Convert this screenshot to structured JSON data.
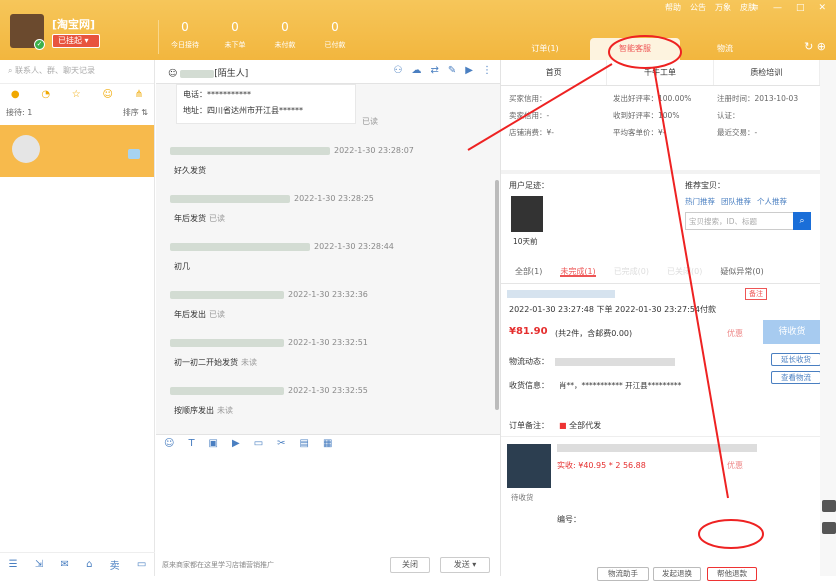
{
  "topbar": {
    "username": "[淘宝网]",
    "status": "已挂起",
    "stats": [
      {
        "num": "0",
        "label": "今日接待"
      },
      {
        "num": "0",
        "label": "未下单"
      },
      {
        "num": "0",
        "label": "未付款"
      },
      {
        "num": "0",
        "label": "已付款"
      }
    ],
    "sysmenu": [
      "帮助",
      "公告",
      "万象",
      "皮肤"
    ],
    "tabs": [
      "订单(1)",
      "智能客服",
      "物流"
    ]
  },
  "left": {
    "search_placeholder": "联系人、群、聊天记录",
    "receive": "接待: 1",
    "sort": "排序 ⇅"
  },
  "chat": {
    "contact": "[陌生人]",
    "card": {
      "phone": "电话：***********",
      "address": "地址：四川省达州市开江县******",
      "read": "已读"
    },
    "messages": [
      {
        "time": "2022-1-30 23:28:07",
        "text": "好久发货",
        "read": ""
      },
      {
        "time": "2022-1-30 23:28:25",
        "text": "年后发货",
        "read": "已读"
      },
      {
        "time": "2022-1-30 23:28:44",
        "text": "初几",
        "read": ""
      },
      {
        "time": "2022-1-30 23:32:36",
        "text": "年后发出",
        "read": "已读"
      },
      {
        "time": "2022-1-30 23:32:51",
        "text": "初一初二开始发货",
        "read": "未读"
      },
      {
        "time": "2022-1-30 23:32:55",
        "text": "按顺序发出",
        "read": "未读"
      }
    ],
    "ad": "原来商家都在这里学习店铺营销推广",
    "close": "关闭",
    "send": "发送"
  },
  "right": {
    "subtabs": [
      "首页",
      "千牛工单",
      "质检培训"
    ],
    "info": {
      "buyer_credit": "买家信用：",
      "seller_credit": "卖家信用：-",
      "shop": "店铺消费：¥-",
      "good_rate_out": "发出好评率：100.00%",
      "good_rate_in": "收到好评率：100%",
      "avg": "平均客单价：¥-",
      "reg": "注册时间：2013-10-03",
      "auth": "认证：",
      "recent": "最近交易：-"
    },
    "footprint": "用户足迹：",
    "footprint_days": "10天前",
    "recommend": "推荐宝贝：",
    "rec_links": [
      "热门推荐",
      "团队推荐",
      "个人推荐"
    ],
    "rec_search": "宝贝搜索，ID、标题",
    "order_tabs": [
      "全部(1)",
      "未完成(1)",
      "已完成(0)",
      "已关闭(0)",
      "疑似异常(0)"
    ],
    "order": {
      "times": "2022-01-30 23:27:48 下单  2022-01-30 23:27:54付款",
      "price": "¥81.90",
      "price_note": "(共2件，含邮费0.00)",
      "discount": "优惠",
      "status": "待收货",
      "logistics": "物流动态：",
      "receiver": "收货信息：",
      "receiver_text": "肖**，*********** 开江县*********",
      "remark": "订单备注：",
      "remark_value": "全部代发",
      "paid": "实收: ¥40.95 * 2  56.88",
      "item_status": "待收货",
      "code": "编号：",
      "extend": "延长收货",
      "view": "查看物流",
      "remark_btn": "备注",
      "btn_logistics": "物流助手",
      "btn_return": "发起退换",
      "btn_refund": "帮他退款"
    }
  }
}
